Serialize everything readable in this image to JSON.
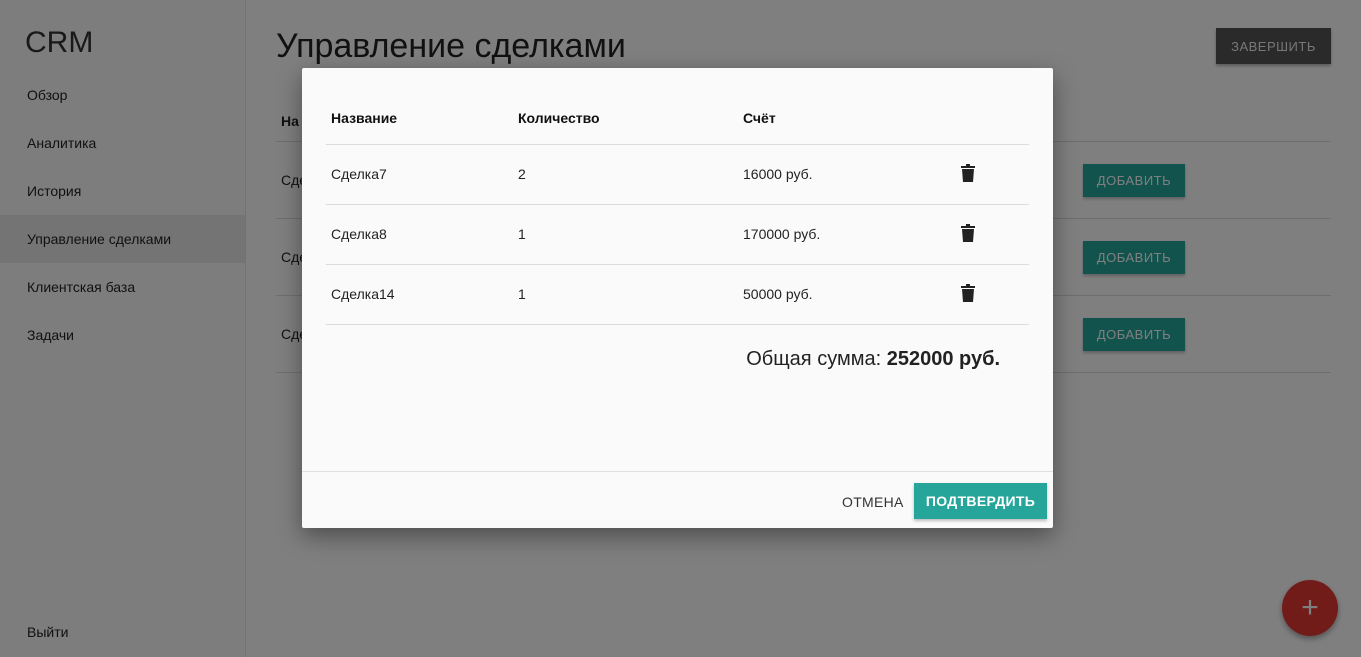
{
  "sidebar": {
    "brand": "CRM",
    "items": [
      {
        "label": "Обзор"
      },
      {
        "label": "Аналитика"
      },
      {
        "label": "История"
      },
      {
        "label": "Управление сделками",
        "active": true
      },
      {
        "label": "Клиентская база"
      },
      {
        "label": "Задачи"
      }
    ],
    "logout": "Выйти"
  },
  "main": {
    "title": "Управление сделками",
    "finish_button": "ЗАВЕРШИТЬ",
    "table_head_partial": "На",
    "rows": [
      {
        "name_partial": "Сде",
        "add_button": "ДОБАВИТЬ"
      },
      {
        "name_partial": "Сде",
        "add_button": "ДОБАВИТЬ"
      },
      {
        "name_partial": "Сде",
        "add_button": "ДОБАВИТЬ"
      }
    ],
    "fab_label": "+"
  },
  "modal": {
    "columns": [
      "Название",
      "Количество",
      "Счёт"
    ],
    "rows": [
      {
        "name": "Сделка7",
        "qty": "2",
        "bill": "16000 руб."
      },
      {
        "name": "Сделка8",
        "qty": "1",
        "bill": "170000 руб."
      },
      {
        "name": "Сделка14",
        "qty": "1",
        "bill": "50000 руб."
      }
    ],
    "total_label": "Общая сумма:",
    "total_value": "252000 руб.",
    "cancel_button": "ОТМЕНА",
    "confirm_button": "ПОДТВЕРДИТЬ"
  },
  "colors": {
    "accent": "#26a69a",
    "fab": "#e53935",
    "finish_button": "#555555"
  }
}
